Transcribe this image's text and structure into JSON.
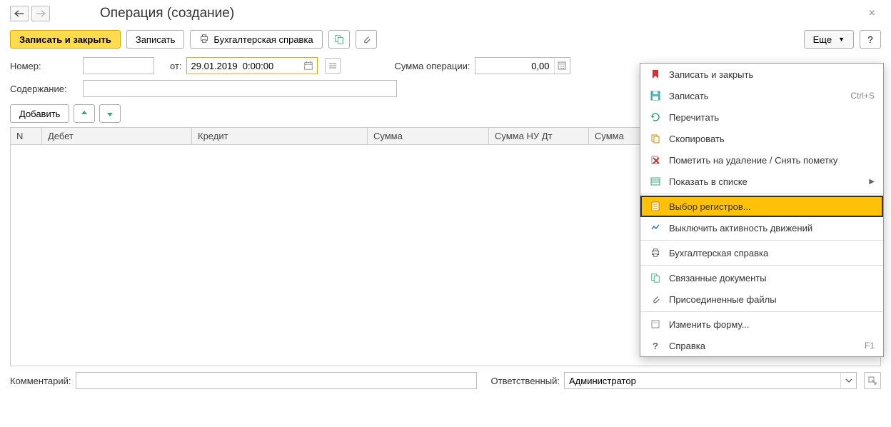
{
  "header": {
    "title": "Операция (создание)"
  },
  "toolbar": {
    "save_close": "Записать и закрыть",
    "save": "Записать",
    "print_ref": "Бухгалтерская справка",
    "more": "Еще",
    "help": "?"
  },
  "fields": {
    "number_label": "Номер:",
    "number_value": "",
    "date_label": "от:",
    "date_value": "29.01.2019  0:00:00",
    "sum_label": "Сумма операции:",
    "sum_value": "0,00",
    "content_label": "Содержание:",
    "content_value": ""
  },
  "grid": {
    "add": "Добавить",
    "cols": {
      "n": "N",
      "debit": "Дебет",
      "credit": "Кредит",
      "sum": "Сумма",
      "sum_nu_dt": "Сумма НУ Дт",
      "sum_tail": "Сумма"
    }
  },
  "footer": {
    "comment_label": "Комментарий:",
    "comment_value": "",
    "responsible_label": "Ответственный:",
    "responsible_value": "Администратор"
  },
  "menu": {
    "items": [
      {
        "icon": "save-close",
        "label": "Записать и закрыть"
      },
      {
        "icon": "disk",
        "label": "Записать",
        "shortcut": "Ctrl+S"
      },
      {
        "icon": "refresh",
        "label": "Перечитать"
      },
      {
        "icon": "copy",
        "label": "Скопировать"
      },
      {
        "icon": "mark-delete",
        "label": "Пометить на удаление / Снять пометку"
      },
      {
        "icon": "list",
        "label": "Показать в списке",
        "submenu": true
      },
      {
        "icon": "registers",
        "label": "Выбор регистров...",
        "selected": true
      },
      {
        "icon": "activity",
        "label": "Выключить активность движений"
      },
      {
        "icon": "printer",
        "label": "Бухгалтерская справка"
      },
      {
        "icon": "related",
        "label": "Связанные документы"
      },
      {
        "icon": "attach",
        "label": "Присоединенные файлы"
      },
      {
        "icon": "form",
        "label": "Изменить форму..."
      },
      {
        "icon": "help",
        "label": "Справка",
        "shortcut": "F1"
      }
    ]
  }
}
